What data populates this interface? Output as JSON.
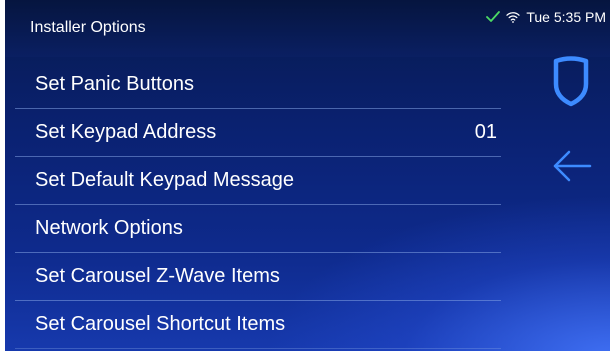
{
  "header": {
    "title": "Installer Options"
  },
  "status": {
    "check_icon": "check-icon",
    "wifi_icon": "wifi-icon",
    "time": "Tue 5:35 PM",
    "check_color": "#4cd964"
  },
  "menu": {
    "items": [
      {
        "label": "Set Panic Buttons",
        "value": ""
      },
      {
        "label": "Set Keypad Address",
        "value": "01"
      },
      {
        "label": "Set Default Keypad Message",
        "value": ""
      },
      {
        "label": "Network Options",
        "value": ""
      },
      {
        "label": "Set Carousel Z-Wave Items",
        "value": ""
      },
      {
        "label": "Set Carousel Shortcut Items",
        "value": ""
      }
    ]
  },
  "side_controls": {
    "shield_icon": "shield-icon",
    "back_icon": "back-arrow-icon",
    "accent_color": "#3d8bff"
  }
}
